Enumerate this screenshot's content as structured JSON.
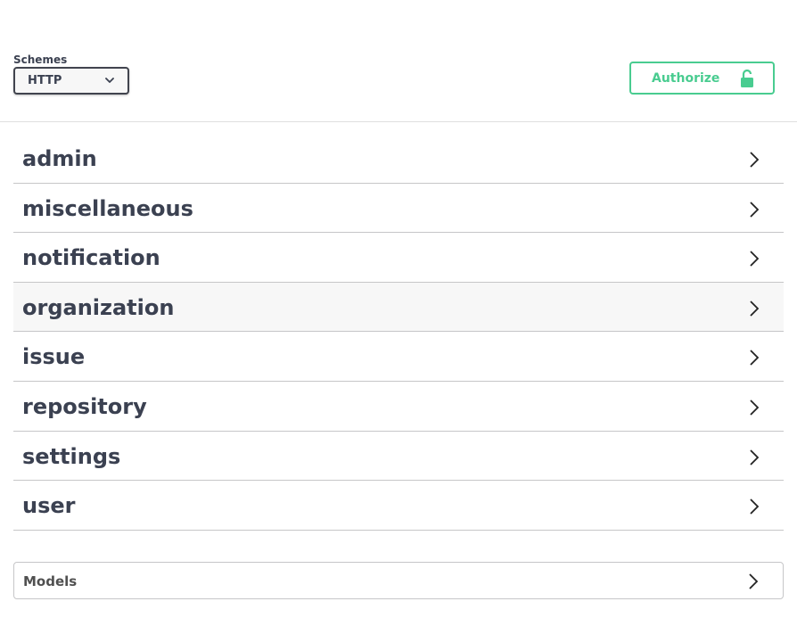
{
  "scheme_bar": {
    "label": "Schemes",
    "selected": "HTTP",
    "authorize_label": "Authorize",
    "chevron_icon": "chevron-down-icon",
    "lock_icon": "unlocked-icon",
    "accent_color": "#49cc90"
  },
  "tags": [
    {
      "name": "admin"
    },
    {
      "name": "miscellaneous"
    },
    {
      "name": "notification"
    },
    {
      "name": "organization"
    },
    {
      "name": "issue"
    },
    {
      "name": "repository"
    },
    {
      "name": "settings"
    },
    {
      "name": "user"
    }
  ],
  "models": {
    "label": "Models"
  },
  "colors": {
    "text": "#3b4151",
    "divider": "#c6c6c8",
    "hover_row": "#f7f7f7"
  }
}
